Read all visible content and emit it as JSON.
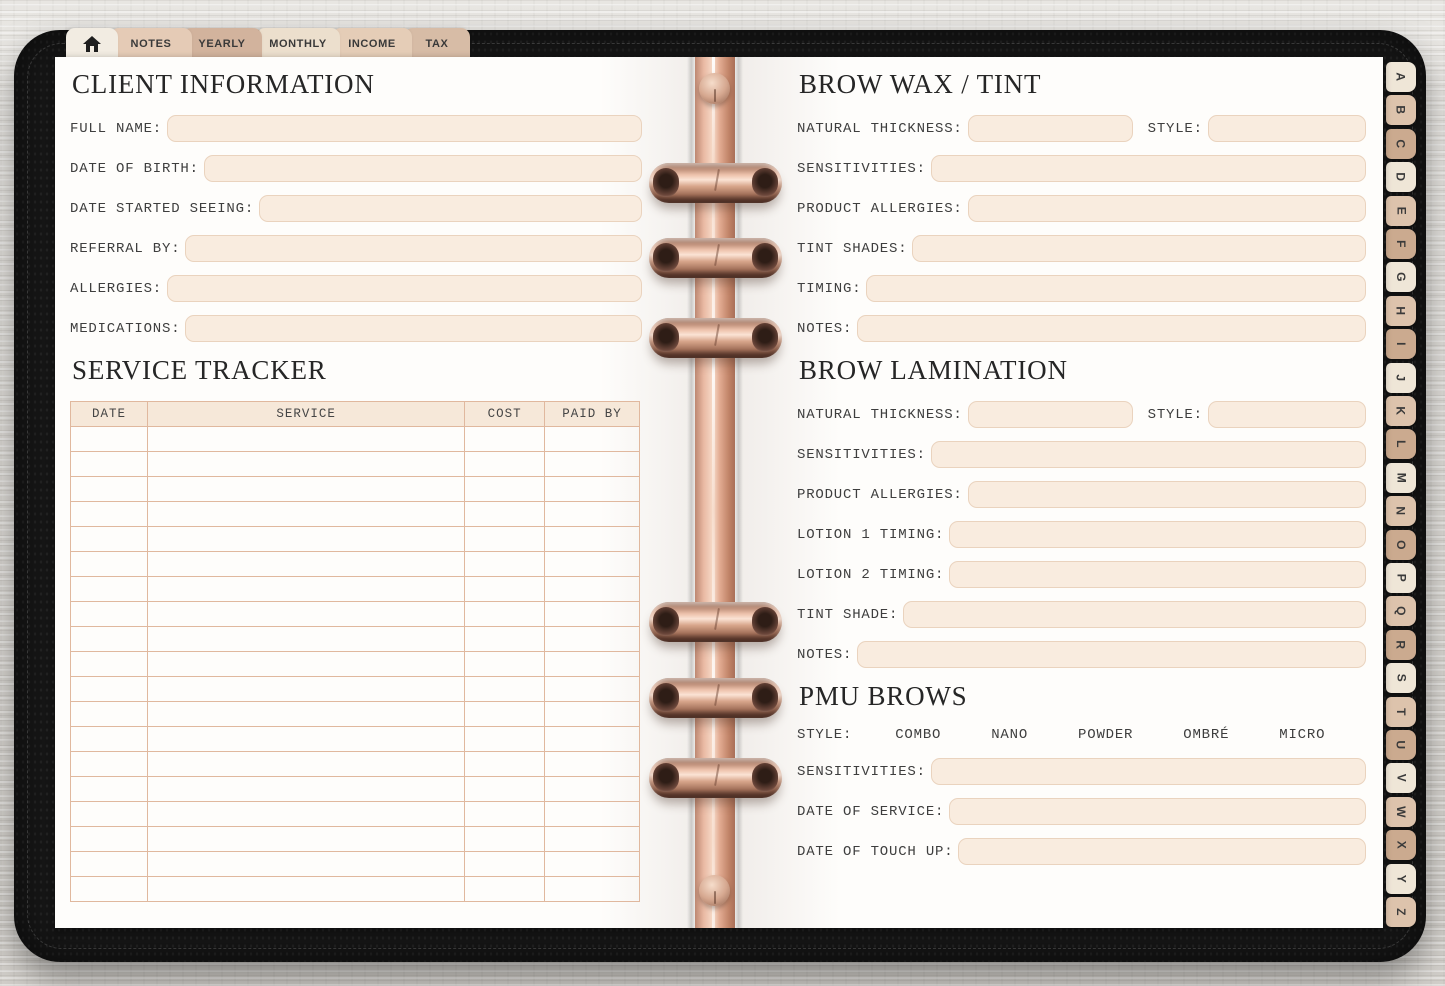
{
  "top_tabs": {
    "home": {
      "icon": "home-icon"
    },
    "items": [
      {
        "id": "notes",
        "label": "NOTES",
        "color": "#e5cbb6"
      },
      {
        "id": "yearly",
        "label": "YEARLY",
        "color": "#d2b39d"
      },
      {
        "id": "monthly",
        "label": "MONTHLY",
        "color": "#ecdfcd"
      },
      {
        "id": "income",
        "label": "INCOME",
        "color": "#e5cdb7"
      },
      {
        "id": "tax",
        "label": "TAX",
        "color": "#d7bca6"
      }
    ]
  },
  "left_page": {
    "client_information": {
      "title": "CLIENT INFORMATION",
      "rows": [
        [
          {
            "label": "FULL NAME:"
          }
        ],
        [
          {
            "label": "DATE OF BIRTH:"
          }
        ],
        [
          {
            "label": "DATE STARTED SEEING:"
          }
        ],
        [
          {
            "label": "REFERRAL BY:"
          }
        ],
        [
          {
            "label": "ALLERGIES:"
          }
        ],
        [
          {
            "label": "MEDICATIONS:"
          }
        ]
      ]
    },
    "service_tracker": {
      "title": "SERVICE TRACKER",
      "columns": [
        "DATE",
        "SERVICE",
        "COST",
        "PAID BY"
      ],
      "empty_rows": 19
    }
  },
  "right_page": {
    "brow_wax_tint": {
      "title": "BROW WAX / TINT",
      "rows": [
        [
          {
            "label": "NATURAL THICKNESS:",
            "w": 165
          },
          {
            "label": "STYLE:"
          }
        ],
        [
          {
            "label": "SENSITIVITIES:"
          }
        ],
        [
          {
            "label": "PRODUCT ALLERGIES:"
          }
        ],
        [
          {
            "label": "TINT SHADES:"
          }
        ],
        [
          {
            "label": "TIMING:"
          }
        ],
        [
          {
            "label": "NOTES:"
          }
        ]
      ]
    },
    "brow_lamination": {
      "title": "BROW LAMINATION",
      "rows": [
        [
          {
            "label": "NATURAL THICKNESS:",
            "w": 165
          },
          {
            "label": "STYLE:"
          }
        ],
        [
          {
            "label": "SENSITIVITIES:"
          }
        ],
        [
          {
            "label": "PRODUCT ALLERGIES:"
          }
        ],
        [
          {
            "label": "LOTION 1 TIMING:"
          }
        ],
        [
          {
            "label": "LOTION 2 TIMING:"
          }
        ],
        [
          {
            "label": "TINT SHADE:"
          }
        ],
        [
          {
            "label": "NOTES:"
          }
        ]
      ]
    },
    "pmu_brows": {
      "title": "PMU BROWS",
      "style_label": "STYLE:",
      "style_options": [
        "COMBO",
        "NANO",
        "POWDER",
        "OMBRÉ",
        "MICRO"
      ],
      "rows": [
        [
          {
            "label": "SENSITIVITIES:"
          }
        ],
        [
          {
            "label": "DATE OF SERVICE:"
          }
        ],
        [
          {
            "label": "DATE OF TOUCH UP:"
          }
        ]
      ]
    }
  },
  "alpha_tabs": {
    "letters": [
      "A",
      "B",
      "C",
      "D",
      "E",
      "F",
      "G",
      "H",
      "I",
      "J",
      "K",
      "L",
      "M",
      "N",
      "O",
      "P",
      "Q",
      "R",
      "S",
      "T",
      "U",
      "V",
      "W",
      "X",
      "Y",
      "Z"
    ],
    "colors": [
      "#efe6d7",
      "#ddc3ac",
      "#cbaa8f"
    ]
  },
  "colors": {
    "field_fill": "#f9ecdf",
    "field_border": "#ead3be",
    "table_border": "#d7a98d",
    "rose_gold": "#d9a58d",
    "cover_black": "#161616",
    "page_white": "#fefdfb"
  }
}
